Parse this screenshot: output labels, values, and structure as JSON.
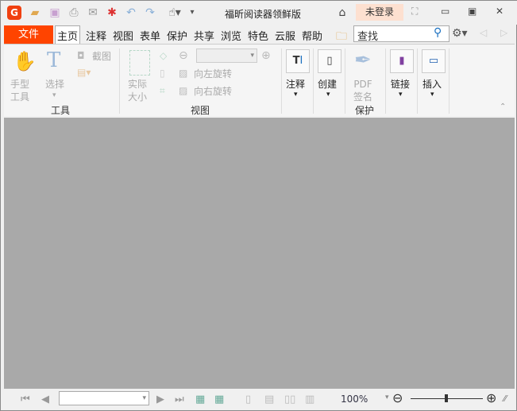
{
  "app": {
    "title": "福昕阅读器领鲜版",
    "login": "未登录"
  },
  "menu": {
    "file": "文件",
    "tabs": [
      "主页",
      "注释",
      "视图",
      "表单",
      "保护",
      "共享",
      "浏览",
      "特色",
      "云服",
      "帮助"
    ]
  },
  "search": {
    "placeholder": "查找"
  },
  "ribbon": {
    "tools": {
      "hand": "手型\n工具",
      "select": "选择",
      "screenshot": "截图",
      "group": "工具"
    },
    "view": {
      "actual": "实际\n大小",
      "rotate_left": "向左旋转",
      "rotate_right": "向右旋转",
      "group": "视图"
    },
    "comment": "注释",
    "create": "创建",
    "pdf_sign": "PDF\n签名",
    "protect_group": "保护",
    "link": "链接",
    "insert": "插入"
  },
  "status": {
    "zoom": "100%"
  }
}
